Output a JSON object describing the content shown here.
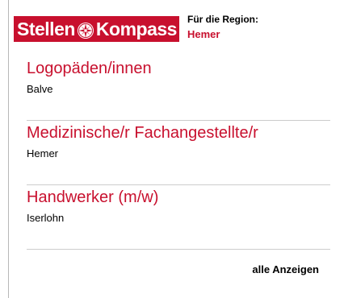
{
  "header": {
    "logo": {
      "text_left": "Stellen",
      "text_right": "Kompass",
      "icon": "compass-icon",
      "brand_color": "#c8102e"
    },
    "region_label": "Für die Region:",
    "region_value": "Hemer"
  },
  "jobs": [
    {
      "title": "Logopäden/innen",
      "location": "Balve"
    },
    {
      "title": "Medizinische/r Fachangestellte/r",
      "location": "Hemer"
    },
    {
      "title": "Handwerker (m/w)",
      "location": "Iserlohn"
    }
  ],
  "footer": {
    "all_link": "alle Anzeigen"
  }
}
